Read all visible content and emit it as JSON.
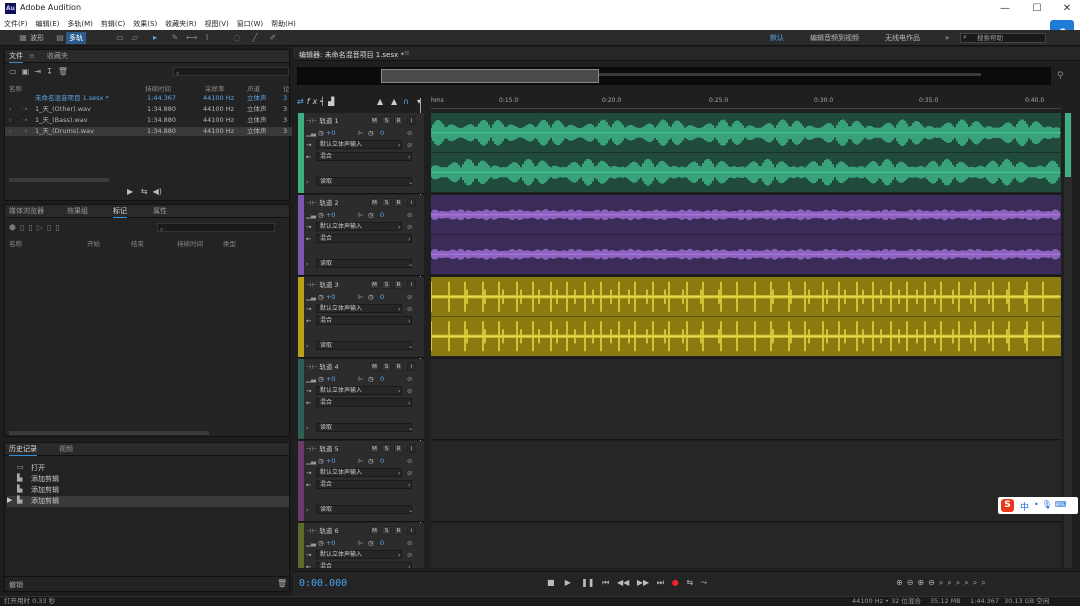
{
  "app": {
    "title": "Adobe Audition",
    "logo": "Au"
  },
  "menu": [
    "文件(F)",
    "编辑(E)",
    "多轨(M)",
    "剪辑(C)",
    "效果(S)",
    "收藏夹(R)",
    "视图(V)",
    "窗口(W)",
    "帮助(H)"
  ],
  "toolbar": {
    "waveform": "波形",
    "multitrack": "多轨",
    "ws_default": "默认",
    "ws_edit": "编辑音频到视频",
    "ws_radio": "无线电作品",
    "search_placeholder": "搜索帮助"
  },
  "files": {
    "tab_files": "文件",
    "tab_fav": "收藏夹",
    "columns": [
      "名称",
      "持续时间",
      "采样率",
      "声道",
      "位"
    ],
    "rows": [
      {
        "name": "未命名混音项目 1.sesx *",
        "dur": "1:44.367",
        "rate": "44100 Hz",
        "ch": "立体声",
        "bit": "3"
      },
      {
        "name": "1_天_(Other).wav",
        "dur": "1:34.880",
        "rate": "44100 Hz",
        "ch": "立体声",
        "bit": "3"
      },
      {
        "name": "1_天_(Bass).wav",
        "dur": "1:34.880",
        "rate": "44100 Hz",
        "ch": "立体声",
        "bit": "3"
      },
      {
        "name": "1_天_(Drums).wav",
        "dur": "1:34.880",
        "rate": "44100 Hz",
        "ch": "立体声",
        "bit": "3"
      }
    ]
  },
  "markers": {
    "tabs": [
      "媒体浏览器",
      "效果组",
      "标记",
      "属性"
    ],
    "columns": [
      "名称",
      "开始",
      "结束",
      "持续时间",
      "类型"
    ]
  },
  "history": {
    "tabs": [
      "历史记录",
      "视频"
    ],
    "items": [
      "打开",
      "添加剪辑",
      "添加剪辑",
      "添加剪辑"
    ],
    "undo": "撤销"
  },
  "editor": {
    "tab": "编辑器: 未命名混音项目 1.sesx *",
    "ruler_unit": "hms",
    "ruler": [
      "0:15.0",
      "0:20.0",
      "0:25.0",
      "0:30.0",
      "0:35.0",
      "0:40.0"
    ],
    "time": "0:00.000"
  },
  "track_common": {
    "vol": "+0",
    "pan": "0",
    "input": "默认立体声输入",
    "output": "混合",
    "mode": "读取",
    "m": "M",
    "s": "S",
    "r": "R"
  },
  "tracks": [
    {
      "name": "轨道 1",
      "color": "#3fae82",
      "bg": "#1f4a3c",
      "wave": "#45c896"
    },
    {
      "name": "轨道 2",
      "color": "#7a58b0",
      "bg": "#3a2b58",
      "wave": "#b07be8"
    },
    {
      "name": "轨道 3",
      "color": "#b8a21c",
      "bg": "#8a7a10",
      "wave": "#f0e048"
    },
    {
      "name": "轨道 4",
      "color": "#2f5e55",
      "bg": "",
      "wave": ""
    },
    {
      "name": "轨道 5",
      "color": "#6a3a6a",
      "bg": "",
      "wave": ""
    },
    {
      "name": "轨道 6",
      "color": "#5e6a2a",
      "bg": "",
      "wave": ""
    }
  ],
  "ime": {
    "logo": "S",
    "lang": "中"
  },
  "status": {
    "left": "打开用时 0.33 秒",
    "rate": "44100 Hz • 32 位混合",
    "size": "35.12 MB",
    "dur": "1:44.367",
    "free": "30.13 GB 空闲"
  }
}
